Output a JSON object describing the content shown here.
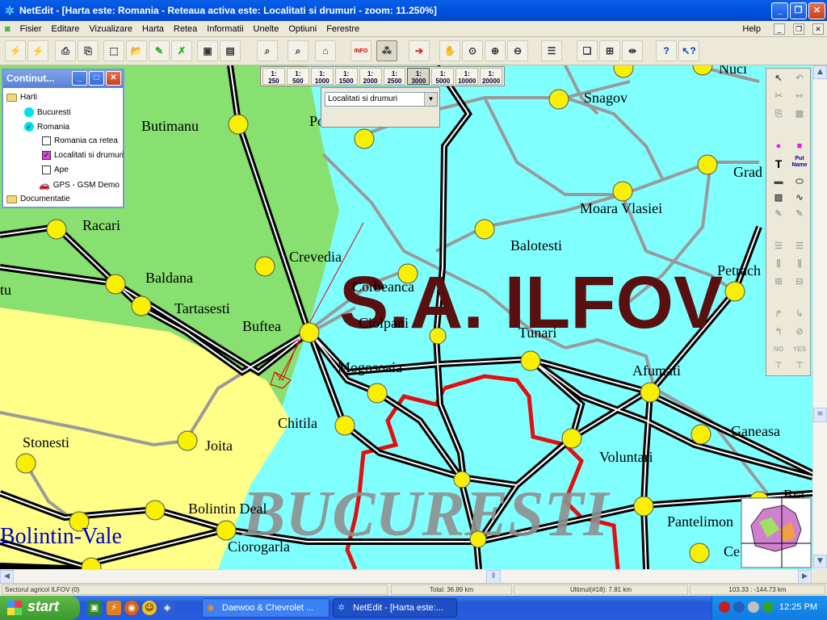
{
  "window": {
    "title": "NetEdit - [Harta este:  Romania - Reteaua activa este:  Localitati si drumuri  - zoom: 11.250%]",
    "buttons": [
      "_",
      "❐",
      "✕"
    ]
  },
  "menu": {
    "items": [
      "Fisier",
      "Editare",
      "Vizualizare",
      "Harta",
      "Retea",
      "Informatii",
      "Unelte",
      "Optiuni",
      "Ferestre"
    ],
    "help": "Help"
  },
  "toolbar": {
    "info_icon_label": "INFO"
  },
  "scale_bar": {
    "buttons": [
      {
        "top": "1:",
        "bottom": "250"
      },
      {
        "top": "1:",
        "bottom": "500"
      },
      {
        "top": "1:",
        "bottom": "1000"
      },
      {
        "top": "1:",
        "bottom": "1500"
      },
      {
        "top": "1:",
        "bottom": "2000"
      },
      {
        "top": "1:",
        "bottom": "2500"
      },
      {
        "top": "1:",
        "bottom": "3000"
      },
      {
        "top": "1:",
        "bottom": "5000"
      },
      {
        "top": "1:",
        "bottom": "10000"
      },
      {
        "top": "1:",
        "bottom": "20000"
      }
    ]
  },
  "layer_select": {
    "value": "Localitati si drumuri"
  },
  "contents_panel": {
    "title": "Continut...",
    "tree": [
      "Harti",
      "Bucuresti",
      "Romania",
      "Romania ca retea",
      "Localitati si drumuri",
      "Ape",
      "GPS - GSM Demo",
      "Documentatie"
    ]
  },
  "map": {
    "big_labels": [
      "S.A. ILFOV",
      "BUCURESTI"
    ],
    "towns": [
      "Snagov",
      "Nuci",
      "Butimanu",
      "Po",
      "Grad",
      "Moara Vlasiei",
      "Racari",
      "Balotesti",
      "Crevedia",
      "Petrach",
      "Baldana",
      "tu",
      "Corbeanca",
      "Tartasesti",
      "Buftea",
      "Ciolpani",
      "Tunari",
      "Mogosoaia",
      "Afumati",
      "Chitila",
      "Ganeasa",
      "Voluntari",
      "Stonesti",
      "Joita",
      "Bolintin Deal",
      "Bolintin-Vale",
      "Pantelimon",
      "Ciorogarla",
      "Ce",
      "Bra"
    ]
  },
  "right_toolbar": {
    "labels": [
      "T",
      "Put Name",
      "NO",
      "YES"
    ]
  },
  "status": {
    "sector": "Sectorul agricol ILFOV    (0)",
    "total": "Total:    36.89 km",
    "last": "Ultimul(#18):    7.81 km",
    "coords": "103.33 : -144.73 km"
  },
  "taskbar": {
    "start": "start",
    "tasks": [
      "Daewoo & Chevrolet ...",
      "NetEdit - [Harta este:..."
    ],
    "clock": "12:25 PM"
  },
  "colors": {
    "titlebar": "#0054e3",
    "map_water": "#80ffff",
    "map_green": "#88e070",
    "map_yellow": "#ffff88",
    "town_dot": "#f8f000",
    "bucharest_border": "#e01010",
    "ilfov_label": "#5a1010",
    "bucuresti_label": "#909090",
    "town_label_blue": "#0000cc"
  }
}
